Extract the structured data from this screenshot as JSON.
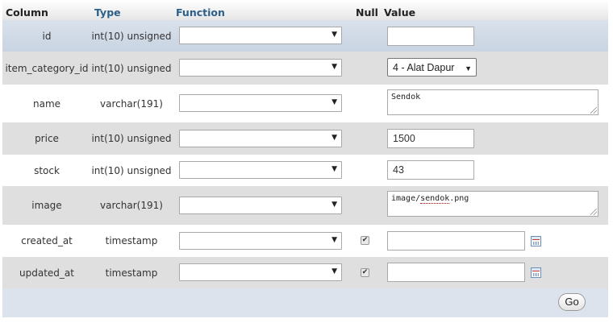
{
  "header": {
    "column": "Column",
    "type": "Type",
    "function": "Function",
    "null": "Null",
    "value": "Value"
  },
  "rows": [
    {
      "name": "id",
      "type": "int(10) unsigned",
      "value": ""
    },
    {
      "name": "item_category_id",
      "type": "int(10) unsigned",
      "value": "4 - Alat Dapur"
    },
    {
      "name": "name",
      "type": "varchar(191)",
      "value": "Sendok"
    },
    {
      "name": "price",
      "type": "int(10) unsigned",
      "value": "1500"
    },
    {
      "name": "stock",
      "type": "int(10) unsigned",
      "value": "43"
    },
    {
      "name": "image",
      "type": "varchar(191)",
      "value_prefix": "image/",
      "value_misspelled": "sendok",
      "value_suffix": ".png"
    },
    {
      "name": "created_at",
      "type": "timestamp",
      "value": "",
      "null_checked": true
    },
    {
      "name": "updated_at",
      "type": "timestamp",
      "value": "",
      "null_checked": true
    }
  ],
  "icons": {
    "select_arrow": "▼",
    "checkbox_mark": "✔",
    "calendar": "calendar-icon"
  },
  "footer": {
    "go_label": "Go"
  }
}
